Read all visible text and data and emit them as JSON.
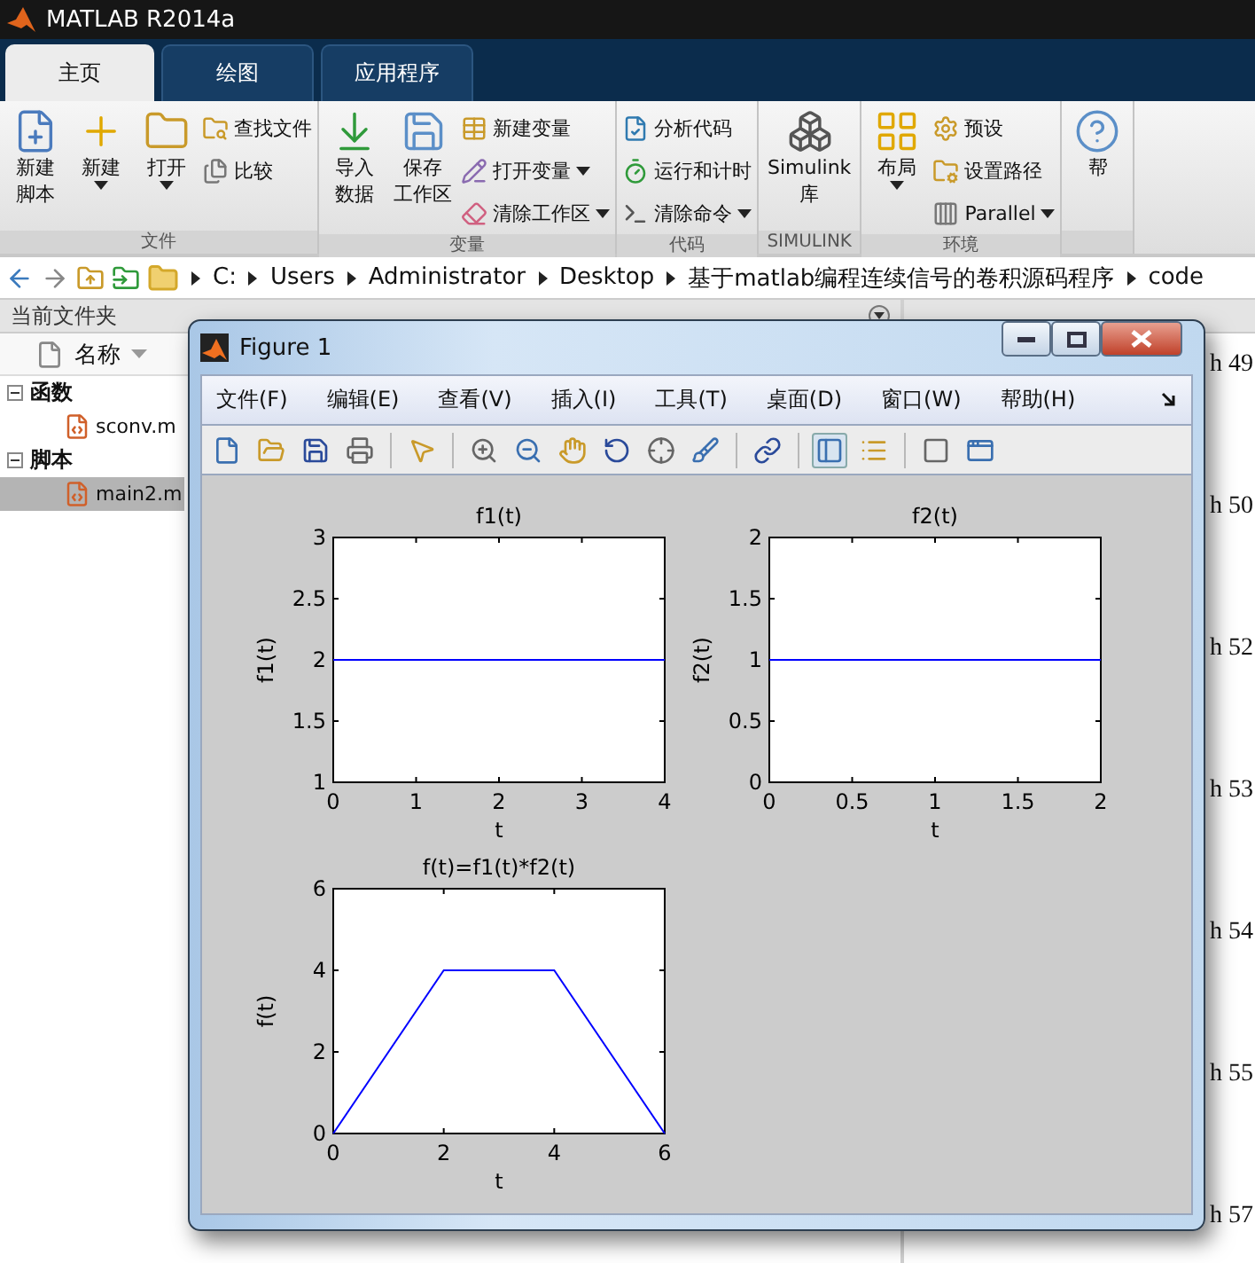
{
  "window": {
    "title": "MATLAB R2014a"
  },
  "tabs": [
    {
      "label": "主页",
      "selected": true
    },
    {
      "label": "绘图",
      "selected": false
    },
    {
      "label": "应用程序",
      "selected": false
    }
  ],
  "ribbon": {
    "groups": [
      {
        "label": "文件",
        "items": [
          {
            "kind": "large",
            "lines": [
              "新建",
              "脚本"
            ],
            "dropdown": false
          },
          {
            "kind": "large",
            "lines": [
              "新建"
            ],
            "dropdown": true
          },
          {
            "kind": "large",
            "lines": [
              "打开"
            ],
            "dropdown": true
          },
          {
            "kind": "small",
            "lines": [
              "查找文件"
            ],
            "dropdown": false
          },
          {
            "kind": "small",
            "lines": [
              "比较"
            ],
            "dropdown": false
          }
        ]
      },
      {
        "label": "变量",
        "items": [
          {
            "kind": "large",
            "lines": [
              "导入",
              "数据"
            ],
            "dropdown": false
          },
          {
            "kind": "large",
            "lines": [
              "保存",
              "工作区"
            ],
            "dropdown": false
          },
          {
            "kind": "small",
            "lines": [
              "新建变量"
            ],
            "dropdown": false
          },
          {
            "kind": "small",
            "lines": [
              "打开变量"
            ],
            "dropdown": true
          },
          {
            "kind": "small",
            "lines": [
              "清除工作区"
            ],
            "dropdown": true
          }
        ]
      },
      {
        "label": "代码",
        "items": [
          {
            "kind": "small",
            "lines": [
              "分析代码"
            ],
            "dropdown": false
          },
          {
            "kind": "small",
            "lines": [
              "运行和计时"
            ],
            "dropdown": false
          },
          {
            "kind": "small",
            "lines": [
              "清除命令"
            ],
            "dropdown": true
          }
        ]
      },
      {
        "label": "SIMULINK",
        "items": [
          {
            "kind": "large",
            "lines": [
              "Simulink",
              "库"
            ],
            "dropdown": false
          }
        ]
      },
      {
        "label": "环境",
        "items": [
          {
            "kind": "large",
            "lines": [
              "布局"
            ],
            "dropdown": true
          },
          {
            "kind": "small",
            "lines": [
              "预设"
            ],
            "dropdown": false
          },
          {
            "kind": "small",
            "lines": [
              "设置路径"
            ],
            "dropdown": false
          },
          {
            "kind": "small",
            "lines": [
              "Parallel"
            ],
            "dropdown": true
          }
        ]
      },
      {
        "items": [
          {
            "kind": "large",
            "lines": [
              "帮"
            ],
            "dropdown": false
          }
        ]
      }
    ]
  },
  "address_bar": {
    "path": [
      "C:",
      "Users",
      "Administrator",
      "Desktop",
      "基于matlab编程连续信号的卷积源码程序",
      "code"
    ]
  },
  "file_panel": {
    "title": "当前文件夹",
    "column": "名称",
    "tree": [
      {
        "label": "函数",
        "expanded": true,
        "children": [
          {
            "label": "sconv.m",
            "selected": false
          }
        ]
      },
      {
        "label": "脚本",
        "expanded": true,
        "children": [
          {
            "label": "main2.m",
            "selected": true
          }
        ]
      }
    ]
  },
  "command_window": {
    "lines": [
      "h 49",
      "h 50",
      "h 52",
      "h 53",
      "h 54",
      "h 55",
      "h 57"
    ]
  },
  "figure": {
    "title": "Figure 1",
    "menu": [
      "文件(F)",
      "编辑(E)",
      "查看(V)",
      "插入(I)",
      "工具(T)",
      "桌面(D)",
      "窗口(W)",
      "帮助(H)"
    ],
    "plots": [
      {
        "chart_data": {
          "type": "line",
          "title": "f1(t)",
          "xlabel": "t",
          "ylabel": "f1(t)",
          "x": [
            0,
            4
          ],
          "series": [
            {
              "color": "#0000ff",
              "values": [
                2,
                2
              ]
            }
          ],
          "xlim": [
            0,
            4
          ],
          "ylim": [
            1,
            3
          ],
          "xticks": [
            0,
            1,
            2,
            3,
            4
          ],
          "yticks": [
            1,
            1.5,
            2,
            2.5,
            3
          ]
        }
      },
      {
        "chart_data": {
          "type": "line",
          "title": "f2(t)",
          "xlabel": "t",
          "ylabel": "f2(t)",
          "x": [
            0,
            2
          ],
          "series": [
            {
              "color": "#0000ff",
              "values": [
                1,
                1
              ]
            }
          ],
          "xlim": [
            0,
            2
          ],
          "ylim": [
            0,
            2
          ],
          "xticks": [
            0,
            0.5,
            1,
            1.5,
            2
          ],
          "yticks": [
            0,
            0.5,
            1,
            1.5,
            2
          ]
        }
      },
      {
        "chart_data": {
          "type": "line",
          "title": "f(t)=f1(t)*f2(t)",
          "xlabel": "t",
          "ylabel": "f(t)",
          "x": [
            0,
            2,
            4,
            6
          ],
          "series": [
            {
              "color": "#0000ff",
              "values": [
                0,
                4,
                4,
                0
              ]
            }
          ],
          "xlim": [
            0,
            6
          ],
          "ylim": [
            0,
            6
          ],
          "xticks": [
            0,
            2,
            4,
            6
          ],
          "yticks": [
            0,
            2,
            4,
            6
          ]
        }
      }
    ]
  }
}
